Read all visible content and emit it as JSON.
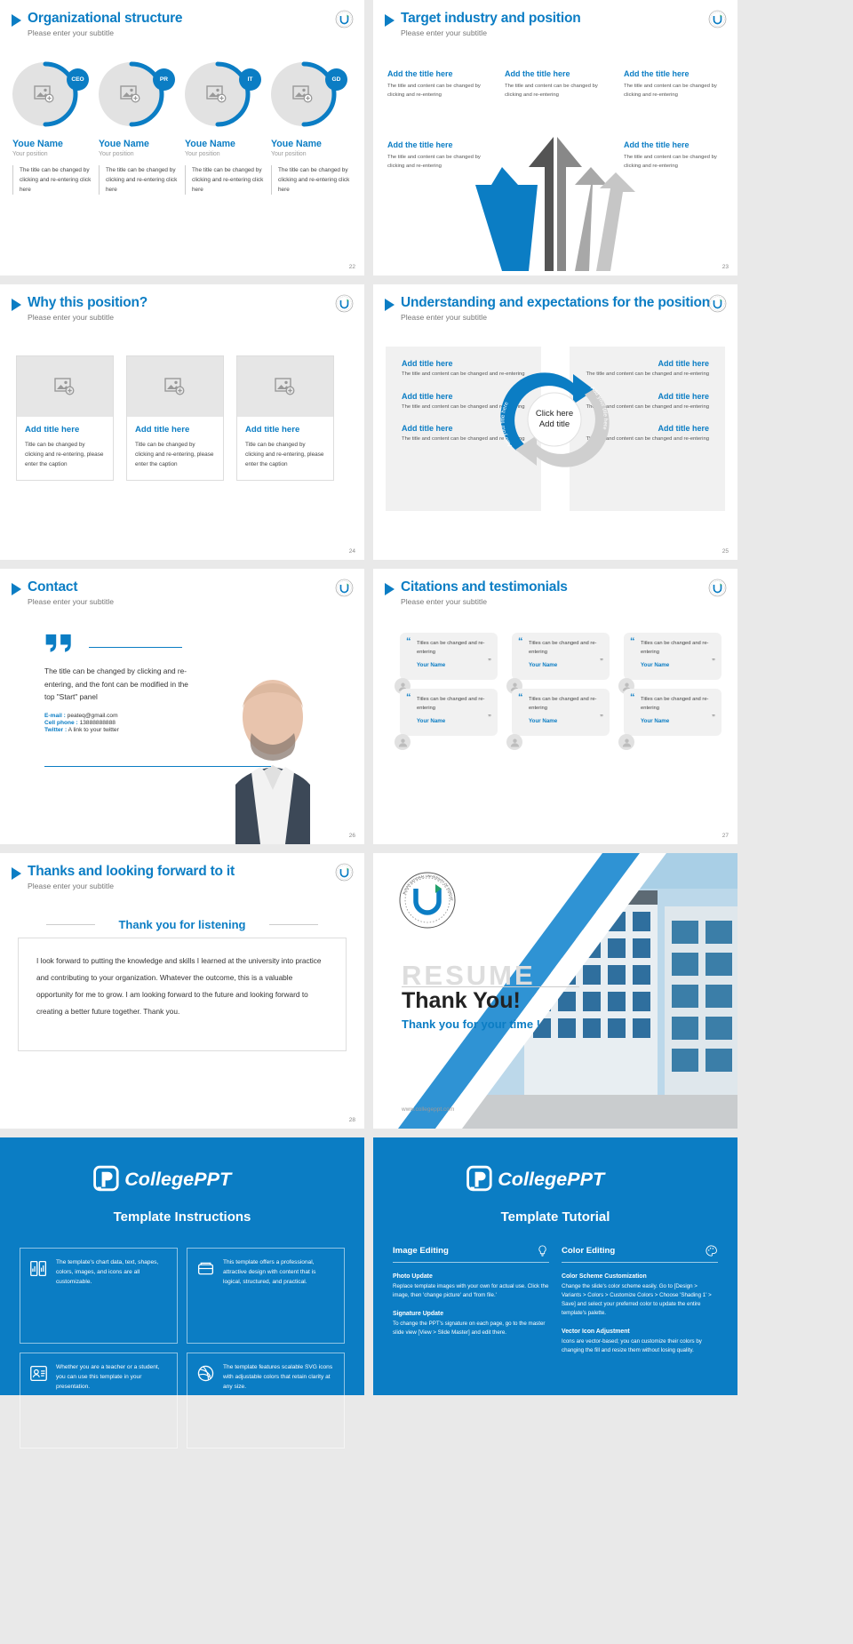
{
  "common": {
    "subtitle": "Please enter your subtitle"
  },
  "slides": [
    {
      "id": "organizational-structure",
      "title": "Organizational structure",
      "page": "22",
      "people": [
        {
          "badge": "CEO",
          "name": "Youe Name",
          "position": "Your position",
          "desc": "The title can be changed by clicking and re-entering click here"
        },
        {
          "badge": "PR",
          "name": "Youe Name",
          "position": "Your position",
          "desc": "The title can be changed by clicking and re-entering click here"
        },
        {
          "badge": "IT",
          "name": "Youe Name",
          "position": "Your position",
          "desc": "The title can be changed by clicking and re-entering click here"
        },
        {
          "badge": "GD",
          "name": "Youe Name",
          "position": "Your position",
          "desc": "The title can be changed by clicking and re-entering click here"
        }
      ]
    },
    {
      "id": "target-industry-and-position",
      "title": "Target industry and position",
      "page": "23",
      "items": [
        {
          "title": "Add the title here",
          "desc": "The title and content can be changed by clicking and re-entering"
        },
        {
          "title": "Add the title here",
          "desc": "The title and content can be changed by clicking and re-entering"
        },
        {
          "title": "Add the title here",
          "desc": "The title and content can be changed by clicking and re-entering"
        },
        {
          "title": "Add the title here",
          "desc": "The title and content can be changed by clicking and re-entering"
        },
        {
          "title": "Add the title here",
          "desc": "The title and content can be changed by clicking and re-entering"
        }
      ]
    },
    {
      "id": "why-this-position",
      "title": "Why this position?",
      "page": "24",
      "cards": [
        {
          "title": "Add title here",
          "desc": "Title can be changed by clicking and re-entering, please enter the caption"
        },
        {
          "title": "Add title here",
          "desc": "Title can be changed by clicking and re-entering, please enter the caption"
        },
        {
          "title": "Add title here",
          "desc": "Title can be changed by clicking and re-entering, please enter the caption"
        }
      ]
    },
    {
      "id": "understanding-and-expectations",
      "title": "Understanding and expectations for the position",
      "page": "25",
      "center": {
        "line1": "Click here",
        "line2": "Add title"
      },
      "ring_left_label": "Add your title here",
      "ring_right_label": "Add your title here",
      "left_items": [
        {
          "title": "Add title here",
          "desc": "The title and content can be changed and re-entering"
        },
        {
          "title": "Add title here",
          "desc": "The title and content can be changed and re-entering"
        },
        {
          "title": "Add title here",
          "desc": "The title and content can be changed and re-entering"
        }
      ],
      "right_items": [
        {
          "title": "Add title here",
          "desc": "The title and content can be changed and re-entering"
        },
        {
          "title": "Add title here",
          "desc": "The title and content can be changed and re-entering"
        },
        {
          "title": "Add title here",
          "desc": "The title and content can be changed and re-entering"
        }
      ]
    },
    {
      "id": "contact",
      "title": "Contact",
      "page": "26",
      "paragraph": "The title can be changed by clicking and re-entering, and the font can be modified in the top \"Start\" panel",
      "details": [
        {
          "label": "E-mail :",
          "value": "peateq@gmail.com"
        },
        {
          "label": "Cell phone :",
          "value": "13888888888"
        },
        {
          "label": "Twitter :",
          "value": "A link to your twitter"
        }
      ]
    },
    {
      "id": "citations-and-testimonials",
      "title": "Citations and testimonials",
      "page": "27",
      "cards": [
        {
          "text": "Titles can be changed and re-entering",
          "name": "Your Name"
        },
        {
          "text": "Titles can be changed and re-entering",
          "name": "Your Name"
        },
        {
          "text": "Titles can be changed and re-entering",
          "name": "Your Name"
        },
        {
          "text": "Titles can be changed and re-entering",
          "name": "Your Name"
        },
        {
          "text": "Titles can be changed and re-entering",
          "name": "Your Name"
        },
        {
          "text": "Titles can be changed and re-entering",
          "name": "Your Name"
        }
      ]
    },
    {
      "id": "thanks-and-looking-forward",
      "title": "Thanks and looking forward to it",
      "page": "28",
      "headline": "Thank you for listening",
      "body": "I look forward to putting the knowledge and skills I learned at the university into practice and contributing to your organization. Whatever the outcome, this is a valuable opportunity for me to grow. I am looking forward to the future and looking forward to creating a better future together. Thank you."
    },
    {
      "id": "thank-you-cover",
      "ghost": "RESUME",
      "big": "Thank You!",
      "sub": "Thank you for your time !",
      "url": "www.collegeppt.com",
      "seal_text": "BUSAN NATIONAL UNIVERSITY OF EDUCATION"
    }
  ],
  "brand": {
    "name_part1": "College",
    "name_part2": "PPT",
    "accent": "#0b7dc4",
    "logo_letter": "P"
  },
  "instructions_panel": {
    "heading": "Template Instructions",
    "cards": [
      {
        "icon": "chart-book-icon",
        "text": "The template's chart data, text, shapes, colors, images, and icons are all customizable."
      },
      {
        "icon": "layers-icon",
        "text": "This template offers a professional, attractive design with content that is logical, structured, and practical."
      },
      {
        "icon": "teacher-icon",
        "text": "Whether you are a teacher or a student, you can use this template in your presentation."
      },
      {
        "icon": "dribbble-icon",
        "text": "The template features scalable SVG icons with adjustable colors that retain clarity at any size."
      }
    ]
  },
  "tutorial_panel": {
    "heading": "Template Tutorial",
    "columns": [
      {
        "title": "Image Editing",
        "icon": "lightbulb-icon",
        "blocks": [
          {
            "title": "Photo Update",
            "desc": "Replace template images with your own for actual use. Click the image, then 'change picture' and 'from file.'"
          },
          {
            "title": "Signature Update",
            "desc": "To change the PPT's signature on each page, go to the master slide view [View > Slide Master] and edit there."
          }
        ]
      },
      {
        "title": "Color Editing",
        "icon": "palette-icon",
        "blocks": [
          {
            "title": "Color Scheme Customization",
            "desc": "Change the slide's color scheme easily. Go to [Design > Variants > Colors > Customize Colors > Choose 'Shading 1' > Save] and select your preferred color to update the entire template's palette."
          },
          {
            "title": "Vector Icon Adjustment",
            "desc": "Icons are vector-based; you can customize their colors by changing the fill and resize them without losing quality."
          }
        ]
      }
    ]
  }
}
